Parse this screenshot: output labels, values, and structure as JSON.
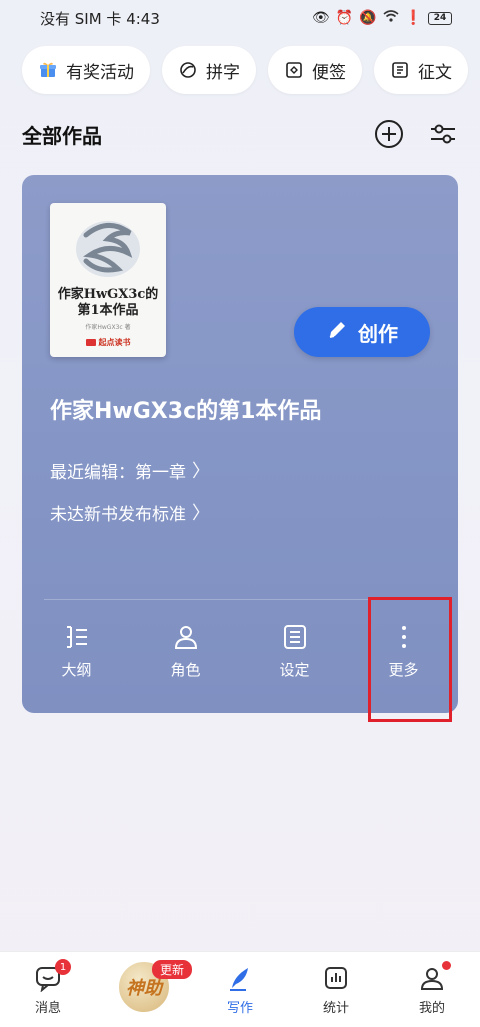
{
  "status_bar": {
    "carrier_time": "没有 SIM 卡 4:43",
    "battery": "24"
  },
  "quick_actions": [
    {
      "label": "有奖活动",
      "icon": "gift-icon"
    },
    {
      "label": "拼字",
      "icon": "swirl-icon"
    },
    {
      "label": "便签",
      "icon": "note-icon"
    },
    {
      "label": "征文",
      "icon": "essay-icon"
    }
  ],
  "section": {
    "title": "全部作品"
  },
  "book": {
    "cover_title": "作家HwGX3c的第1本作品",
    "cover_author": "作家HwGX3c 著",
    "cover_brand": "起点读书",
    "title": "作家HwGX3c的第1本作品",
    "last_edit": "最近编辑：第一章",
    "publish_note": "未达新书发布标准",
    "create_label": "创作"
  },
  "tools": [
    {
      "label": "大纲",
      "icon": "outline-icon"
    },
    {
      "label": "角色",
      "icon": "person-icon"
    },
    {
      "label": "设定",
      "icon": "settings-list-icon"
    },
    {
      "label": "更多",
      "icon": "more-vertical-icon"
    }
  ],
  "tabbar": {
    "messages": {
      "label": "消息",
      "badge": "1"
    },
    "assistant": {
      "logo_text": "神助",
      "badge": "更新"
    },
    "write": {
      "label": "写作"
    },
    "stats": {
      "label": "统计"
    },
    "mine": {
      "label": "我的"
    }
  },
  "colors": {
    "accent": "#2f6ee6",
    "card": "#8596c6",
    "badge": "#e8323a",
    "highlight": "#e0212b"
  }
}
